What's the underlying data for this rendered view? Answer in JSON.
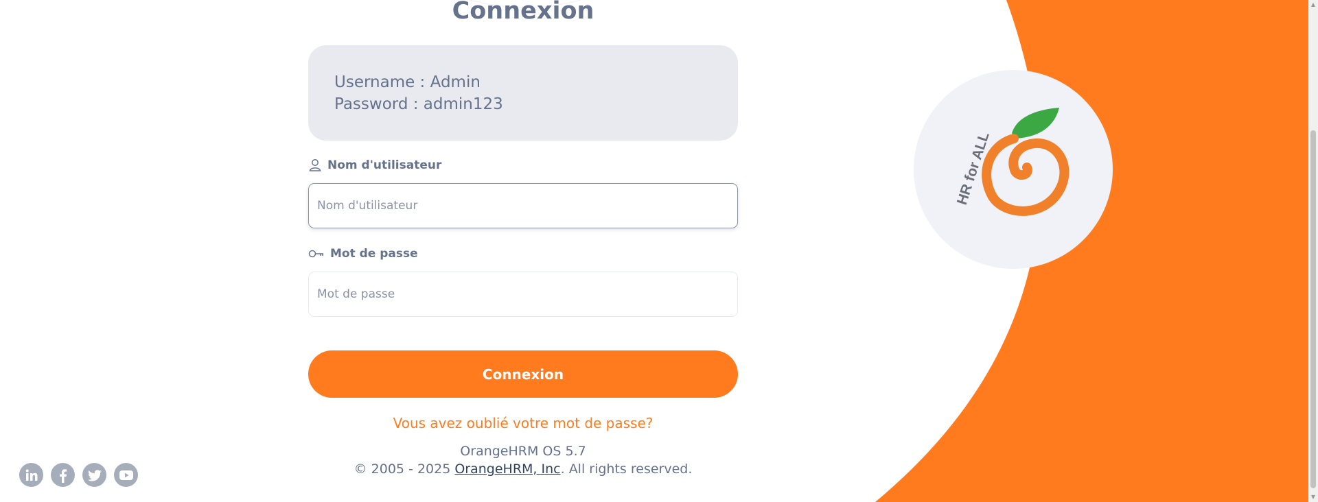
{
  "page": {
    "title": "Connexion",
    "credentials": {
      "username_line": "Username : Admin",
      "password_line": "Password : admin123"
    },
    "username_field": {
      "label": "Nom d'utilisateur",
      "placeholder": "Nom d'utilisateur",
      "value": ""
    },
    "password_field": {
      "label": "Mot de passe",
      "placeholder": "Mot de passe",
      "value": ""
    },
    "login_button": "Connexion",
    "forgot_password": "Vous avez oublié votre mot de passe?",
    "footer": {
      "version": "OrangeHRM OS 5.7",
      "copyright_prefix": "© 2005 - 2025 ",
      "company_link": "OrangeHRM, Inc",
      "copyright_suffix": ". All rights reserved."
    }
  },
  "social_icons": [
    "linkedin-icon",
    "facebook-icon",
    "twitter-icon",
    "youtube-icon"
  ],
  "logo": {
    "text": "HR for ALL",
    "icon": "orange-fruit-logo"
  },
  "colors": {
    "brand_orange": "#ff7b1d",
    "text_slate": "#64728c",
    "credential_bg": "#e8eaef",
    "leaf_green": "#3ca844"
  }
}
